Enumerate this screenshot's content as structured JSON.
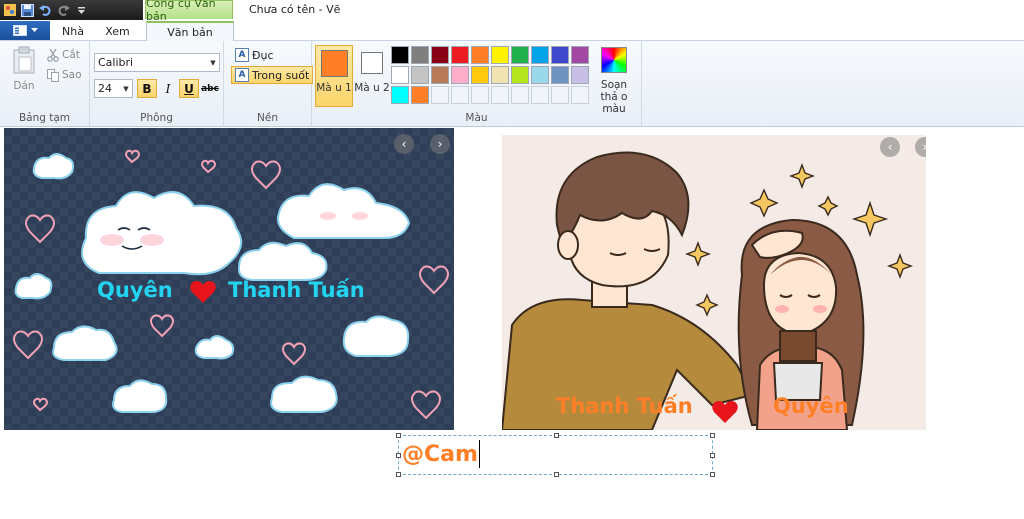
{
  "window": {
    "context_tab": "Công cụ Văn bản",
    "doc_title": "Chưa có tên - Vẽ"
  },
  "tabs": {
    "home": "Nhà",
    "view": "Xem",
    "text": "Văn bản"
  },
  "clipboard": {
    "paste": "Dán",
    "cut": "Cắt",
    "copy": "Sao",
    "group_label": "Bảng tạm"
  },
  "font": {
    "family": "Calibri",
    "size": "24",
    "bold": "B",
    "italic": "I",
    "underline": "U",
    "strike": "abc",
    "group_label": "Phông"
  },
  "background": {
    "opaque": "Đục",
    "transparent": "Trong suốt",
    "group_label": "Nền"
  },
  "colors": {
    "color1_label": "Mà u 1",
    "color2_label": "Mà u 2",
    "color1": "#ff7f27",
    "color2": "#ffffff",
    "palette": [
      "#000000",
      "#7f7f7f",
      "#880015",
      "#ed1c24",
      "#ff7f27",
      "#fff200",
      "#22b14c",
      "#00a2e8",
      "#3f48cc",
      "#a349a4",
      "#ffffff",
      "#c3c3c3",
      "#b97a57",
      "#ffaec9",
      "#ffc90e",
      "#efe4b0",
      "#b5e61d",
      "#99d9ea",
      "#7092be",
      "#c8bfe7",
      "#00ffff",
      "#ff7f27",
      "",
      "",
      "",
      "",
      "",
      "",
      "",
      ""
    ],
    "edit_label": "Soạn thả o màu",
    "group_label": "Màu"
  },
  "canvas": {
    "left_name_1": "Quyên",
    "left_name_2": "Thanh Tuấn",
    "right_name_1": "Thanh Tuấn",
    "right_name_2": "Quyên",
    "left_text_color": "#22d4f0",
    "right_text_color": "#ff7f27",
    "heart_color": "#e8141c",
    "textbox_value": "@Cam"
  }
}
